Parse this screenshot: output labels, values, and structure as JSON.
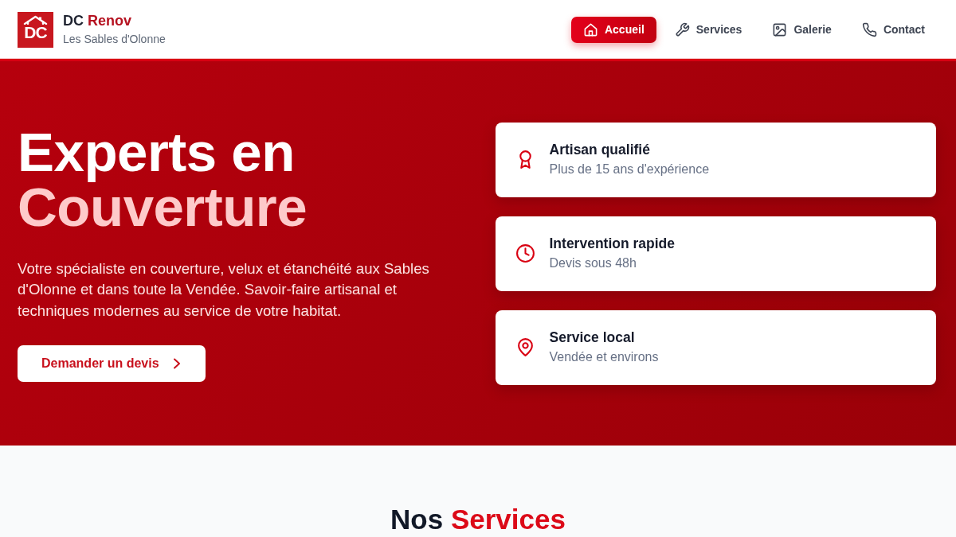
{
  "header": {
    "logo": {
      "letters": "DC"
    },
    "brand": {
      "name": "DC",
      "accent": "Renov"
    },
    "tagline": "Les Sables d'Olonne",
    "nav": [
      {
        "label": "Accueil",
        "selected": true
      },
      {
        "label": "Services",
        "selected": false
      },
      {
        "label": "Galerie",
        "selected": false
      },
      {
        "label": "Contact",
        "selected": false
      }
    ]
  },
  "hero": {
    "title_line_1": "Experts en",
    "title_line_2": "Couverture",
    "text": "Votre spécialiste en couverture, velux et étanchéité aux Sables d'Olonne et dans toute la Vendée. Savoir-faire artisanal et techniques modernes au service de votre habitat.",
    "cta": "Demander un devis",
    "features": [
      {
        "title": "Artisan qualifié",
        "subtitle": "Plus de 15 ans d'expérience"
      },
      {
        "title": "Intervention rapide",
        "subtitle": "Devis sous 48h"
      },
      {
        "title": "Service local",
        "subtitle": "Vendée et environs"
      }
    ]
  },
  "services_section": {
    "title": "Nos",
    "title_accent": "Services"
  }
}
